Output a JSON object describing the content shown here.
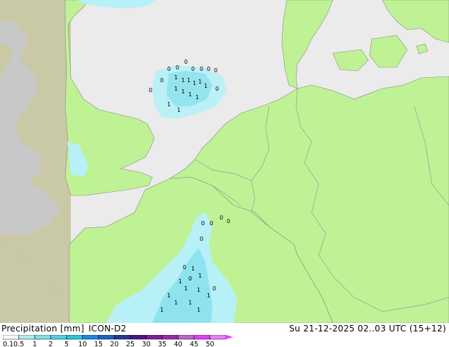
{
  "header": {
    "variable": "Precipitation [mm]",
    "model": "ICON-D2",
    "datetime": "Su 21-12-2025 02..03 UTC (15+12)"
  },
  "colors": {
    "sea": "#ebebeb",
    "land_in_domain": "#bff294",
    "outside_domain": "#c8c8c8",
    "outside_land": "#c9c9a6",
    "border": "#999999",
    "precip_light": "#b8f0f8",
    "precip_medium": "#78dce8"
  },
  "legend": {
    "tick_labels": [
      "0.1",
      "0.5",
      "1",
      "2",
      "5",
      "10",
      "15",
      "20",
      "25",
      "30",
      "35",
      "40",
      "45",
      "50"
    ],
    "colors": [
      "#ffffff",
      "#b2ebf2",
      "#80deea",
      "#4dd0e1",
      "#26c6da",
      "#1e88e5",
      "#1565c0",
      "#283593",
      "#4a148c",
      "#7b1fa2",
      "#9c27b0",
      "#ba68c8",
      "#e040fb",
      "#ea80fc"
    ]
  },
  "labels": {
    "north_sea_1": [
      "0",
      "0",
      "0",
      "0",
      "0",
      "0",
      "0",
      "0",
      "0",
      "0"
    ],
    "north_sea_2": [
      "1",
      "1",
      "1",
      "1",
      "1",
      "1",
      "1",
      "1",
      "1",
      "1",
      "1",
      "1"
    ],
    "south_1": [
      "0",
      "0",
      "0",
      "0",
      "0",
      "0",
      "0",
      "0"
    ],
    "south_2": [
      "1",
      "1",
      "1",
      "1",
      "1",
      "1",
      "1",
      "1",
      "1",
      "1",
      "1"
    ]
  }
}
